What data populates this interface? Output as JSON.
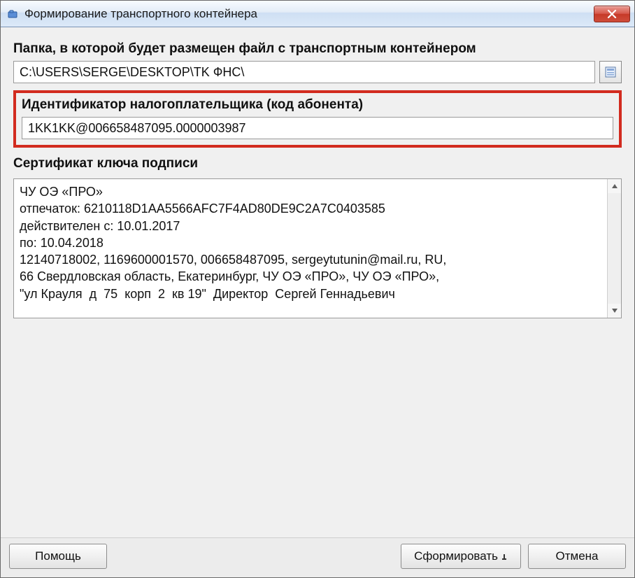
{
  "window": {
    "title": "Формирование транспортного контейнера"
  },
  "folder": {
    "label": "Папка, в которой будет размещен файл с транспортным контейнером",
    "value": "C:\\USERS\\SERGE\\DESKTOP\\TK ФНС\\"
  },
  "taxpayer_id": {
    "label": "Идентификатор налогоплательщика (код абонента)",
    "value": "1KK1KK@006658487095.0000003987"
  },
  "cert": {
    "label": "Сертификат ключа подписи",
    "text": "ЧУ ОЭ «ПРО»\nотпечаток: 6210118D1AA5566AFC7F4AD80DE9C2A7C0403585\nдействителен с: 10.01.2017\nпо: 10.04.2018\n12140718002, 1169600001570, 006658487095, sergeytutunin@mail.ru, RU,\n66 Свердловская область, Екатеринбург, ЧУ ОЭ «ПРО», ЧУ ОЭ «ПРО»,\n\"ул Крауля  д  75  корп  2  кв 19\"  Директор  Сергей Геннадьевич"
  },
  "buttons": {
    "help": "Помощь",
    "generate": "Сформировать",
    "cancel": "Отмена"
  }
}
